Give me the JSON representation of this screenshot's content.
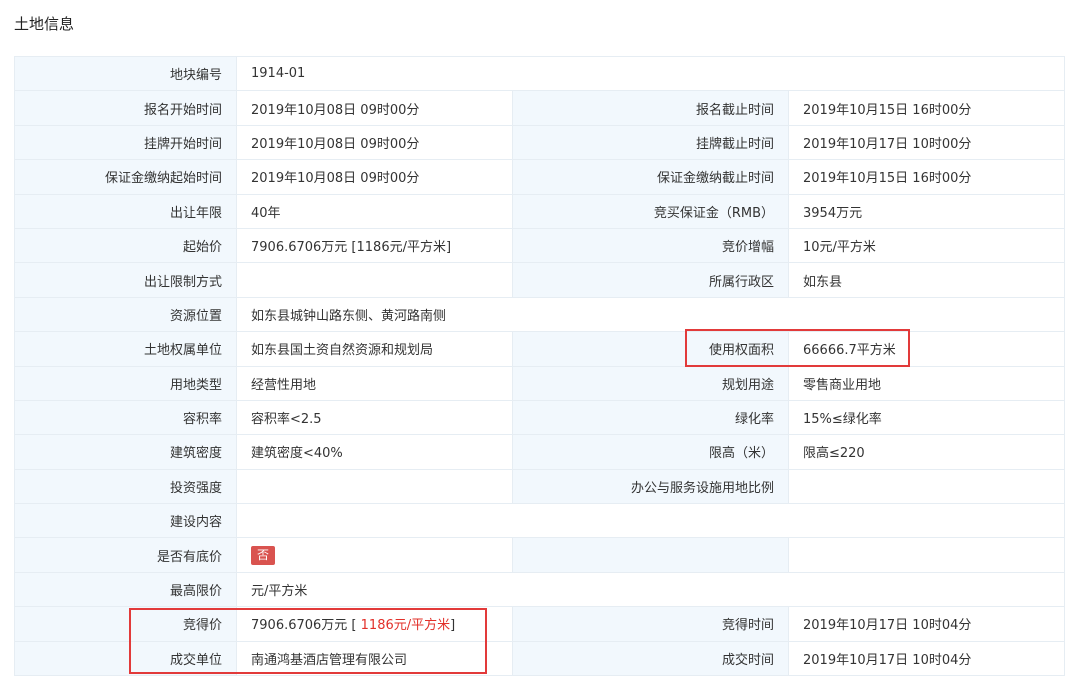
{
  "page": {
    "title": "土地信息"
  },
  "rows": [
    {
      "l1": "地块编号",
      "v1": "1914-01"
    },
    {
      "l1": "报名开始时间",
      "v1": "2019年10月08日 09时00分",
      "l2": "报名截止时间",
      "v2": "2019年10月15日 16时00分"
    },
    {
      "l1": "挂牌开始时间",
      "v1": "2019年10月08日 09时00分",
      "l2": "挂牌截止时间",
      "v2": "2019年10月17日 10时00分"
    },
    {
      "l1": "保证金缴纳起始时间",
      "v1": "2019年10月08日 09时00分",
      "l2": "保证金缴纳截止时间",
      "v2": "2019年10月15日 16时00分"
    },
    {
      "l1": "出让年限",
      "v1": "40年",
      "l2": "竞买保证金（RMB）",
      "v2": "3954万元"
    },
    {
      "l1": "起始价",
      "v1": "7906.6706万元 [1186元/平方米]",
      "l2": "竞价增幅",
      "v2": "10元/平方米"
    },
    {
      "l1": "出让限制方式",
      "v1": "",
      "l2": "所属行政区",
      "v2": "如东县"
    },
    {
      "l1": "资源位置",
      "v1": "如东县城钟山路东侧、黄河路南侧"
    },
    {
      "l1": "土地权属单位",
      "v1": "如东县国土资自然资源和规划局",
      "l2": "使用权面积",
      "v2": "66666.7平方米"
    },
    {
      "l1": "用地类型",
      "v1": "经营性用地",
      "l2": "规划用途",
      "v2": "零售商业用地"
    },
    {
      "l1": "容积率",
      "v1": "容积率<2.5",
      "l2": "绿化率",
      "v2": "15%≤绿化率"
    },
    {
      "l1": "建筑密度",
      "v1": "建筑密度<40%",
      "l2": "限高（米）",
      "v2": "限高≤220"
    },
    {
      "l1": "投资强度",
      "v1": "",
      "l2": "办公与服务设施用地比例",
      "v2": ""
    },
    {
      "l1": "建设内容",
      "v1": ""
    },
    {
      "l1": "是否有底价",
      "badge": "否"
    },
    {
      "l1": "最高限价",
      "v1": "元/平方米"
    },
    {
      "l1": "竞得价",
      "v1_prefix": "7906.6706万元 [",
      "v1_red": " 1186元/平方米",
      "v1_suffix": "]",
      "l2": "竞得时间",
      "v2": "2019年10月17日 10时04分"
    },
    {
      "l1": "成交单位",
      "v1": "南通鸿基酒店管理有限公司",
      "l2": "成交时间",
      "v2": "2019年10月17日 10时04分"
    }
  ],
  "colors": {
    "label_bg": "#f2f8fd",
    "border": "#e6edf3",
    "highlight": "#e23a3a",
    "badge": "#d9534f",
    "red_text": "#e2302a"
  }
}
